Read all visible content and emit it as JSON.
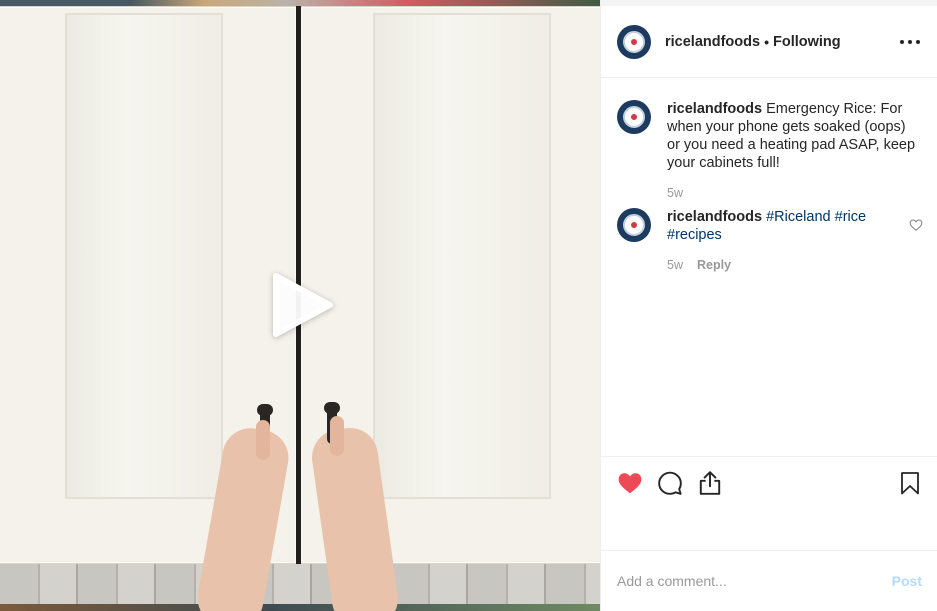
{
  "post": {
    "media": {
      "type": "video",
      "play_icon": "play-icon"
    },
    "header": {
      "username": "ricelandfoods",
      "separator": "•",
      "follow_status": "Following",
      "more_icon": "more-horizontal-icon"
    },
    "caption": {
      "username": "ricelandfoods",
      "text": "Emergency Rice: For when your phone gets soaked (oops) or you need a heating pad ASAP, keep your cabinets full!",
      "age": "5w"
    },
    "comments": [
      {
        "username": "ricelandfoods",
        "hashtags": [
          "#Riceland",
          "#rice",
          "#recipes"
        ],
        "age": "5w",
        "reply_label": "Reply"
      }
    ],
    "actions": {
      "like_icon": "heart-icon",
      "liked": true,
      "comment_icon": "comment-icon",
      "share_icon": "share-icon",
      "save_icon": "bookmark-icon"
    },
    "add_comment": {
      "placeholder": "Add a comment...",
      "post_label": "Post"
    }
  },
  "colors": {
    "liked_heart": "#ed4956",
    "hashtag": "#003569",
    "post_button_disabled": "#b3dbff",
    "avatar_bg": "#1d3a5f"
  }
}
